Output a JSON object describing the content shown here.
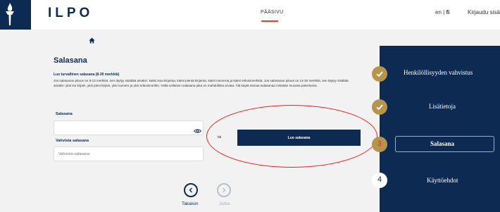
{
  "header": {
    "brand": "ILPO",
    "nav_home": "PÄÄSIVU",
    "lang_en": "en",
    "lang_sep": " | ",
    "lang_fi": "fi",
    "login": "Kirjaudu sisään"
  },
  "form": {
    "title": "Salasana",
    "subtitle": "Luo turvallinen salasana (8-30 merkkiä)",
    "description": "Jos salasanan pituus on 8-13 merkkiä, sen täytyy sisältää ainakin: kaksi isoa kirjainta, kaksi pientä kirjainta, kaksi numeroa ja kaksi erikoismerkkiä. Jos salasanan pituus on 14-30 merkkiä, sen täytyy sisältää ainakin: yksi iso kirjain, yksi pieni kirjain, yksi numero ja yksi erikoismerkki. Vältä sellaisen salasana joka on mahdollista arvata. Älä käytä samaa salasanaa missään muussa palvelussa.",
    "password_label": "Salasana",
    "password_value": "",
    "confirm_label": "Vahvista salasana",
    "confirm_placeholder": "Vahvista salasana",
    "or_label": "tai",
    "generate_button": "Luo salasana"
  },
  "navigation": {
    "back_label": "Takaisin",
    "next_label": "Jatka"
  },
  "steps": [
    {
      "label": "Henkilöllisyyden vahvistus",
      "status": "done"
    },
    {
      "label": "Lisätietoja",
      "status": "done"
    },
    {
      "label": "Salasana",
      "status": "current",
      "number": "3"
    },
    {
      "label": "Käyttöehdot",
      "status": "todo",
      "number": "4"
    }
  ],
  "colors": {
    "navy": "#0d2b52",
    "gold": "#b7944c",
    "accent_red": "#e8412b",
    "annotation_red": "#e62020"
  },
  "icons": {
    "logo": "torch-icon",
    "home": "home-icon",
    "eye": "eye-icon",
    "back": "chevron-left-icon",
    "next": "chevron-right-icon",
    "check": "check-icon"
  }
}
